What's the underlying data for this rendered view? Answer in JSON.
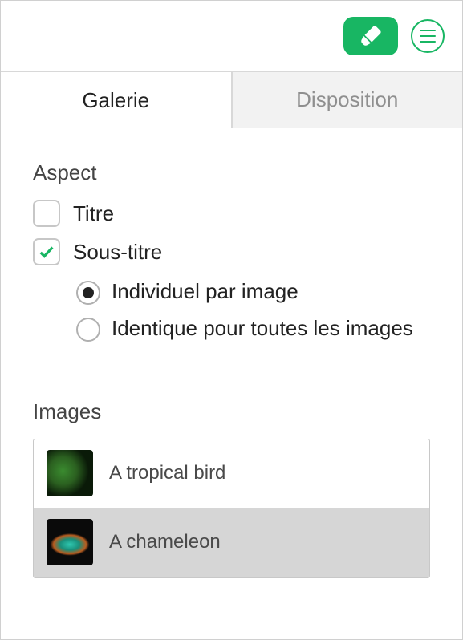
{
  "toolbar": {
    "format_icon": "paintbrush-icon",
    "menu_icon": "list-icon"
  },
  "tabs": {
    "gallery": {
      "label": "Galerie",
      "active": true
    },
    "layout": {
      "label": "Disposition",
      "active": false
    }
  },
  "aspect": {
    "title": "Aspect",
    "title_checkbox": {
      "label": "Titre",
      "checked": false
    },
    "subtitle_checkbox": {
      "label": "Sous-titre",
      "checked": true
    },
    "subtitle_mode": {
      "per_image": {
        "label": "Individuel par image",
        "selected": true
      },
      "same_all": {
        "label": "Identique pour toutes les images",
        "selected": false
      }
    }
  },
  "images": {
    "title": "Images",
    "items": [
      {
        "label": "A tropical bird",
        "thumb": "bird",
        "selected": false
      },
      {
        "label": "A chameleon",
        "thumb": "chameleon",
        "selected": true
      }
    ]
  }
}
